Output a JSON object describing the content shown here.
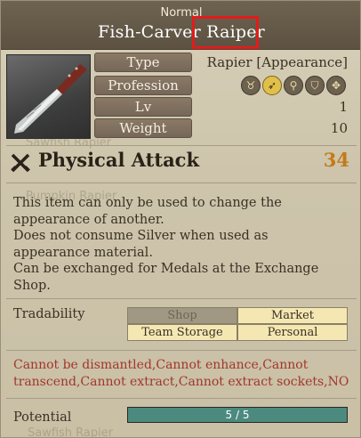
{
  "header": {
    "grade": "Normal",
    "item_name": "Fish-Carver Raiper"
  },
  "stats": {
    "type": {
      "label": "Type",
      "value": "Rapier [Appearance]"
    },
    "profession": {
      "label": "Profession",
      "icons": [
        "horns-icon",
        "bow-icon",
        "key-icon",
        "shield-icon",
        "cross-icon"
      ],
      "active_index": 1
    },
    "lv": {
      "label": "Lv",
      "value": "1"
    },
    "weight": {
      "label": "Weight",
      "value": "10"
    }
  },
  "attack": {
    "label": "Physical Attack",
    "value": "34",
    "value_color": "#c47a18"
  },
  "description": [
    "This item can only be used to change the",
    "appearance of another.",
    "Does not consume Silver when used as",
    "appearance material.",
    "Can be exchanged for Medals at the Exchange",
    "Shop."
  ],
  "tradability": {
    "label": "Tradability",
    "cells": [
      {
        "text": "Shop",
        "enabled": false
      },
      {
        "text": "Market",
        "enabled": true
      },
      {
        "text": "Team Storage",
        "enabled": true
      },
      {
        "text": "Personal",
        "enabled": true
      }
    ]
  },
  "restrictions": [
    "Cannot be dismantled,Cannot enhance,Cannot",
    "transcend,Cannot extract,Cannot extract sockets,NO"
  ],
  "potential": {
    "label": "Potential",
    "text": "5 / 5",
    "fraction": 1.0,
    "color": "#4c8a80"
  },
  "background_list": [
    "Sawfish Rapier",
    "Pumpkin Rapier",
    "Sawfish Rapier"
  ]
}
